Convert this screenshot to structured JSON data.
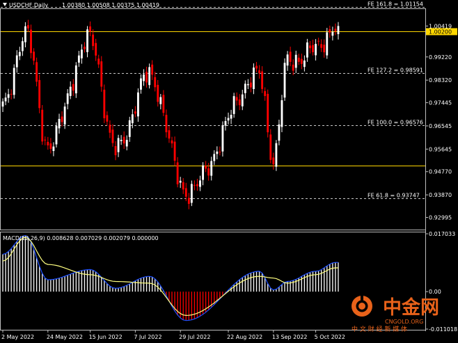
{
  "header": {
    "symbol": "USDCHF,Daily",
    "ohlc": "1.00380 1.00508 1.00375 1.00419",
    "dropdown_icon": "triangle-down-icon"
  },
  "chart_data": [
    {
      "type": "candlestick",
      "title": "USDCHF,Daily",
      "ylim": [
        0.9255,
        1.0105
      ],
      "y_ticks": [
        "1.00419",
        "1.00200",
        "0.99220",
        "0.98320",
        "0.97445",
        "0.96545",
        "0.95645",
        "0.94770",
        "0.93870",
        "0.92995"
      ],
      "x_ticks": [
        "2 May 2022",
        "24 May 2022",
        "15 Jun 2022",
        "7 Jul 2022",
        "29 Jul 2022",
        "22 Aug 2022",
        "13 Sep 2022",
        "5 Oct 2022"
      ],
      "colors": {
        "up": "#ffffff",
        "down": "#ff0000",
        "level_line": "#ffd700",
        "fib_line": "#c8c8c8"
      },
      "key_points": [
        {
          "date": "2 May 2022",
          "close": 0.972
        },
        {
          "date": "13 May 2022",
          "close": 1.002
        },
        {
          "date": "24 May 2022",
          "close": 0.958
        },
        {
          "date": "15 Jun 2022",
          "close": 0.999
        },
        {
          "date": "27 Jun 2022",
          "close": 0.956
        },
        {
          "date": "14 Jul 2022",
          "close": 0.985
        },
        {
          "date": "1 Aug 2022",
          "close": 0.94
        },
        {
          "date": "7 Sep 2022",
          "close": 0.985
        },
        {
          "date": "13 Sep 2022",
          "close": 0.953
        },
        {
          "date": "21 Sep 2022",
          "close": 0.99
        },
        {
          "date": "5 Oct 2022",
          "close": 0.995
        },
        {
          "date": "14 Oct 2022",
          "close": 1.0042
        }
      ],
      "levels": [
        {
          "label": "1.00200",
          "value": 1.002
        },
        {
          "label": "0.95000",
          "value": 0.95
        }
      ],
      "fib_levels": [
        {
          "label": "FE 161.8 = 1.01154",
          "value": 1.01154
        },
        {
          "label": "FE 127.2 = 0.98591",
          "value": 0.98591
        },
        {
          "label": "FE 100.0 = 0.96576",
          "value": 0.96576
        },
        {
          "label": "FE 61.8 = 0.93747",
          "value": 0.93747
        }
      ]
    },
    {
      "type": "macd",
      "title": "MACD(12,26,9) 0.008628 0.007029 0.002079 0.000000",
      "ylim": [
        -0.011018,
        0.017033
      ],
      "y_ticks": [
        "0.017033",
        "0.00",
        "-0.011018"
      ],
      "colors": {
        "histogram_up": "#ffffff",
        "histogram_down": "#ff0000",
        "macd_line": "#1e50ff",
        "signal_line": "#ffff80"
      },
      "key_points": [
        {
          "date": "2 May 2022",
          "macd": 0.011,
          "signal": 0.009
        },
        {
          "date": "13 May 2022",
          "macd": 0.0165,
          "signal": 0.016
        },
        {
          "date": "24 May 2022",
          "macd": 0.0035,
          "signal": 0.008
        },
        {
          "date": "15 Jun 2022",
          "macd": 0.0065,
          "signal": 0.005
        },
        {
          "date": "27 Jun 2022",
          "macd": 0.001,
          "signal": 0.003
        },
        {
          "date": "14 Jul 2022",
          "macd": 0.0045,
          "signal": 0.0025
        },
        {
          "date": "1 Aug 2022",
          "macd": -0.0085,
          "signal": -0.007
        },
        {
          "date": "7 Sep 2022",
          "macd": 0.006,
          "signal": 0.0045
        },
        {
          "date": "13 Sep 2022",
          "macd": 0.0005,
          "signal": 0.004
        },
        {
          "date": "21 Sep 2022",
          "macd": 0.003,
          "signal": 0.0025
        },
        {
          "date": "5 Oct 2022",
          "macd": 0.006,
          "signal": 0.005
        },
        {
          "date": "14 Oct 2022",
          "macd": 0.0086,
          "signal": 0.007
        }
      ]
    }
  ],
  "watermark": {
    "brand": "中金网",
    "domain": "CNGOLD.ORG",
    "tagline": "中 文 财 经 新 媒 体",
    "brand_color": "#e8621a",
    "icon": "gold-coin-logo-icon"
  }
}
